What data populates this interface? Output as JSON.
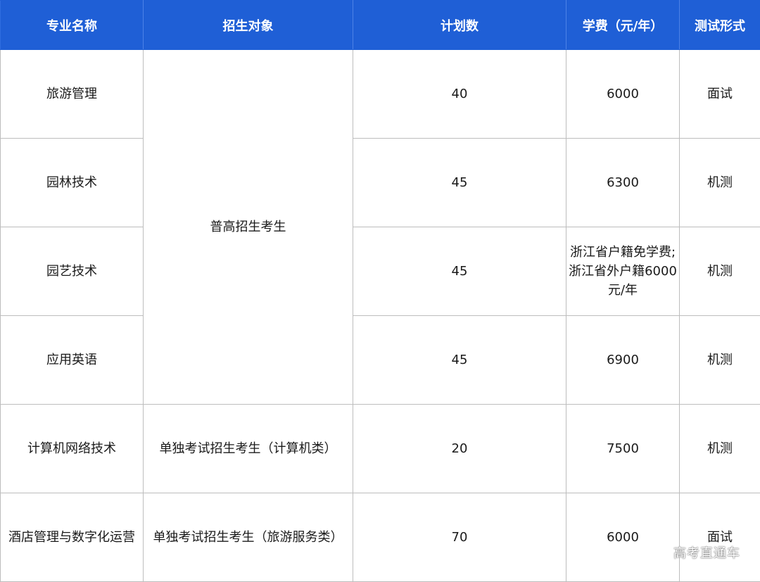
{
  "header": {
    "col1": "专业名称",
    "col2": "招生对象",
    "col3": "计划数",
    "col4": "学费（元/年）",
    "col5": "测试形式"
  },
  "rows": [
    {
      "major": "旅游管理",
      "target": "普高招生考生",
      "plan": "40",
      "fee": "6000",
      "test": "面试"
    },
    {
      "major": "园林技术",
      "plan": "45",
      "fee": "6300",
      "test": "机测"
    },
    {
      "major": "园艺技术",
      "plan": "45",
      "fee": "浙江省户籍免学费;浙江省外户籍6000元/年",
      "test": "机测"
    },
    {
      "major": "应用英语",
      "plan": "45",
      "fee": "6900",
      "test": "机测"
    },
    {
      "major": "计算机网络技术",
      "target": "单独考试招生考生（计算机类）",
      "plan": "20",
      "fee": "7500",
      "test": "机测"
    },
    {
      "major": "酒店管理与数字化运营",
      "target": "单独考试招生考生（旅游服务类）",
      "plan": "70",
      "fee": "6000",
      "test": "面试"
    }
  ],
  "watermark": "高考直通车",
  "colors": {
    "header_bg": "#1f5fd6",
    "header_text": "#ffffff",
    "border": "#bdbdbd"
  }
}
